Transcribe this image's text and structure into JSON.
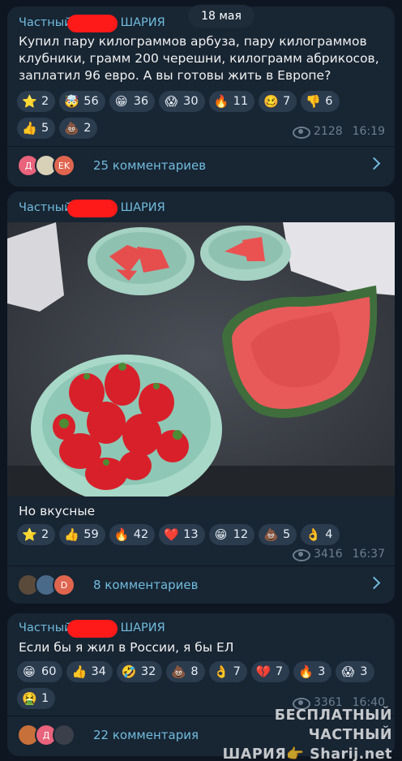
{
  "date_label": "18 мая",
  "posts": [
    {
      "sender_pre": "Частный",
      "sender_post": "ШАРИЯ",
      "text": "Купил пару килограммов арбуза, пару килограммов клубники, грамм 200 черешни, килограмм абрикосов, заплатил 96 евро. А вы готовы жить в Европе?",
      "reactions": [
        {
          "emoji": "⭐",
          "count": "2"
        },
        {
          "emoji": "🤯",
          "count": "56"
        },
        {
          "emoji": "😁",
          "count": "36"
        },
        {
          "emoji": "😱",
          "count": "30"
        },
        {
          "emoji": "🔥",
          "count": "11"
        },
        {
          "emoji": "🥴",
          "count": "7"
        },
        {
          "emoji": "👎",
          "count": "6"
        },
        {
          "emoji": "👍",
          "count": "5"
        },
        {
          "emoji": "💩",
          "count": "2"
        }
      ],
      "views": "2128",
      "time": "16:19",
      "comments_label": "25 комментариев",
      "avatars": [
        {
          "label": "Д",
          "color": "#e8637b"
        },
        {
          "label": "",
          "color": "#d9d0b8"
        },
        {
          "label": "EK",
          "color": "#e0654f"
        }
      ]
    },
    {
      "sender_pre": "Частный",
      "sender_post": "ШАРИЯ",
      "text": "Но вкусные",
      "reactions": [
        {
          "emoji": "⭐",
          "count": "2"
        },
        {
          "emoji": "👍",
          "count": "59"
        },
        {
          "emoji": "🔥",
          "count": "42"
        },
        {
          "emoji": "❤️",
          "count": "13"
        },
        {
          "emoji": "😁",
          "count": "12"
        },
        {
          "emoji": "💩",
          "count": "5"
        },
        {
          "emoji": "👌",
          "count": "4"
        }
      ],
      "views": "3416",
      "time": "16:37",
      "comments_label": "8 комментариев",
      "avatars": [
        {
          "label": "",
          "color": "#5a4a3a"
        },
        {
          "label": "",
          "color": "#4a6a8a"
        },
        {
          "label": "D",
          "color": "#e0654f"
        }
      ]
    },
    {
      "sender_pre": "Частный",
      "sender_post": "ШАРИЯ",
      "text": "Если бы я жил в России, я бы ЕЛ",
      "reactions": [
        {
          "emoji": "😁",
          "count": "60"
        },
        {
          "emoji": "👍",
          "count": "34"
        },
        {
          "emoji": "🤣",
          "count": "32"
        },
        {
          "emoji": "💩",
          "count": "8"
        },
        {
          "emoji": "👌",
          "count": "7"
        },
        {
          "emoji": "💔",
          "count": "7"
        },
        {
          "emoji": "🔥",
          "count": "3"
        },
        {
          "emoji": "😱",
          "count": "3"
        },
        {
          "emoji": "🤮",
          "count": "1"
        }
      ],
      "views": "3361",
      "time": "16:40",
      "comments_label": "22 комментария",
      "avatars": [
        {
          "label": "",
          "color": "#c8703a"
        },
        {
          "label": "Д",
          "color": "#e8637b"
        },
        {
          "label": "",
          "color": "#3a3f4a"
        }
      ]
    }
  ],
  "watermark_line1": "БЕСПЛАТНЫЙ ЧАСТНЫЙ",
  "watermark_line2": "ШАРИЯ👉 Sharij.net",
  "colors": {
    "background": "#0e1621",
    "bubble": "#182533",
    "accent": "#71bcde",
    "reaction_pill": "#2b3c4f",
    "redaction": "#ff1a1a"
  }
}
